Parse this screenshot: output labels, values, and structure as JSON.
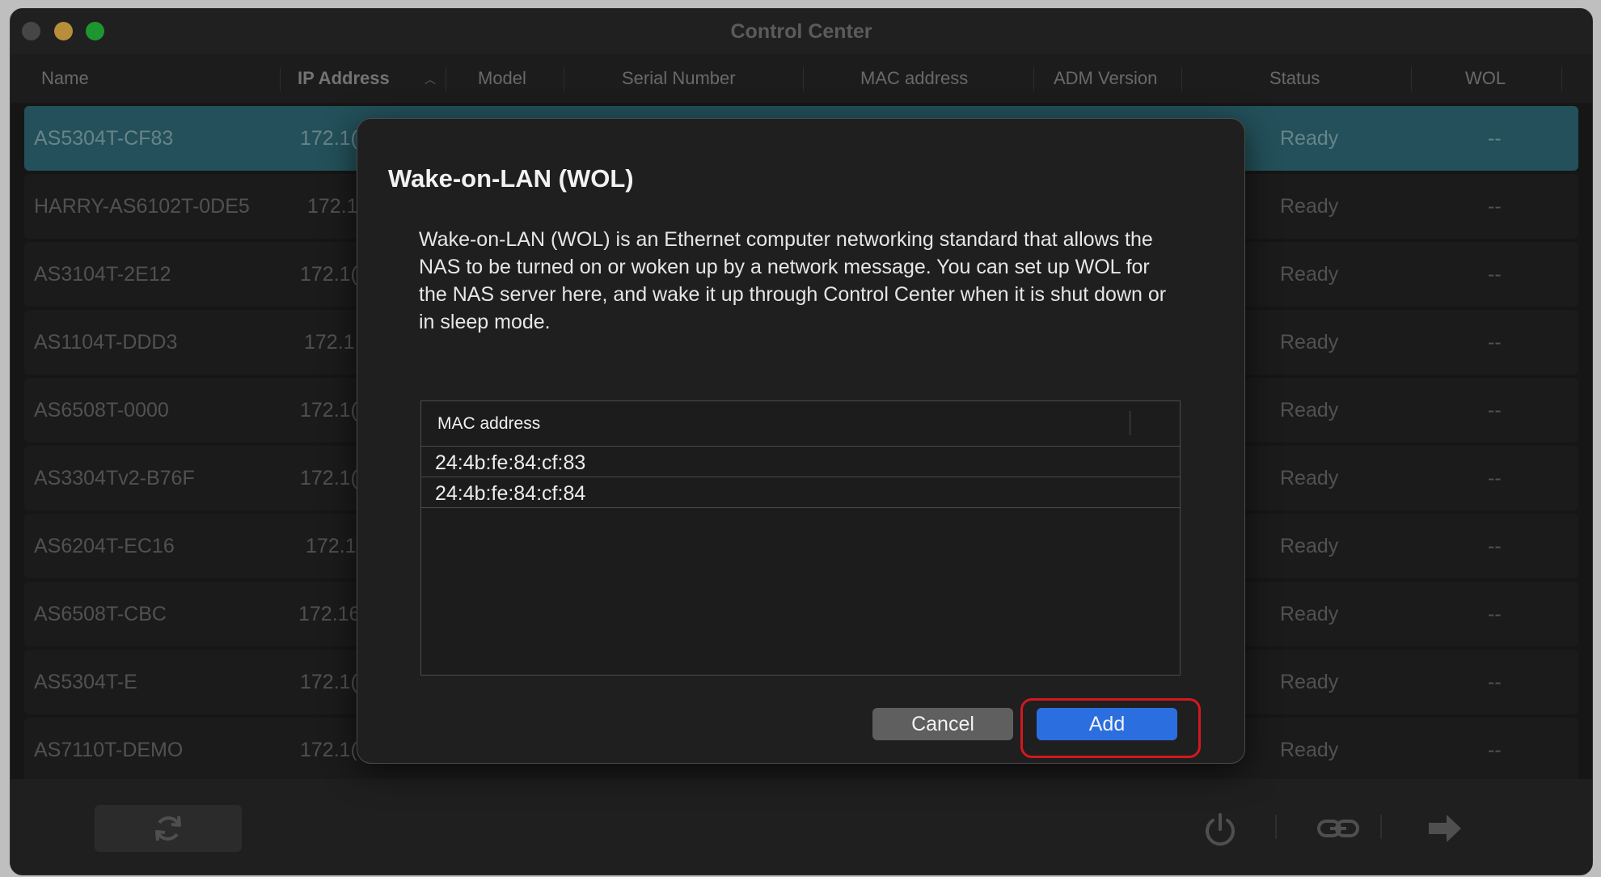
{
  "window": {
    "title": "Control Center"
  },
  "columns": [
    "Name",
    "IP Address",
    "Model",
    "Serial Number",
    "MAC address",
    "ADM Version",
    "Status",
    "WOL"
  ],
  "devices": [
    {
      "name": "AS5304T-CF83",
      "ip": "172.1(",
      "status": "Ready",
      "wol": "--",
      "selected": true
    },
    {
      "name": "HARRY-AS6102T-0DE5",
      "ip": "172.1",
      "status": "Ready",
      "wol": "--"
    },
    {
      "name": "AS3104T-2E12",
      "ip": "172.1(",
      "status": "Ready",
      "wol": "--"
    },
    {
      "name": "AS1104T-DDD3",
      "ip": "172.1",
      "status": "Ready",
      "wol": "--"
    },
    {
      "name": "AS6508T-0000",
      "ip": "172.1(",
      "status": "Ready",
      "wol": "--"
    },
    {
      "name": "AS3304Tv2-B76F",
      "ip": "172.1(",
      "status": "Ready",
      "wol": "--"
    },
    {
      "name": "AS6204T-EC16",
      "ip": "172.1",
      "status": "Ready",
      "wol": "--"
    },
    {
      "name": "AS6508T-CBC",
      "ip": "172.16",
      "status": "Ready",
      "wol": "--"
    },
    {
      "name": "AS5304T-E",
      "ip": "172.1(",
      "status": "Ready",
      "wol": "--"
    },
    {
      "name": "AS7110T-DEMO",
      "ip": "172.1(",
      "status": "Ready",
      "wol": "--"
    }
  ],
  "dialog": {
    "title": "Wake-on-LAN (WOL)",
    "description": "Wake-on-LAN (WOL) is an Ethernet computer networking standard that allows the NAS to be turned on or woken up by a network message. You can set up WOL for the NAS server here, and wake it up through Control Center when it is shut down or in sleep mode.",
    "table_header": "MAC address",
    "mac_addresses": [
      "24:4b:fe:84:cf:83",
      "24:4b:fe:84:cf:84"
    ],
    "cancel_label": "Cancel",
    "add_label": "Add"
  },
  "toolbar_icons": [
    "refresh-icon",
    "power-icon",
    "link-icon",
    "arrow-right-icon"
  ],
  "colors": {
    "selected_row": "#2f6b78",
    "add_button": "#2b6ee0",
    "highlight": "#d3181f"
  }
}
